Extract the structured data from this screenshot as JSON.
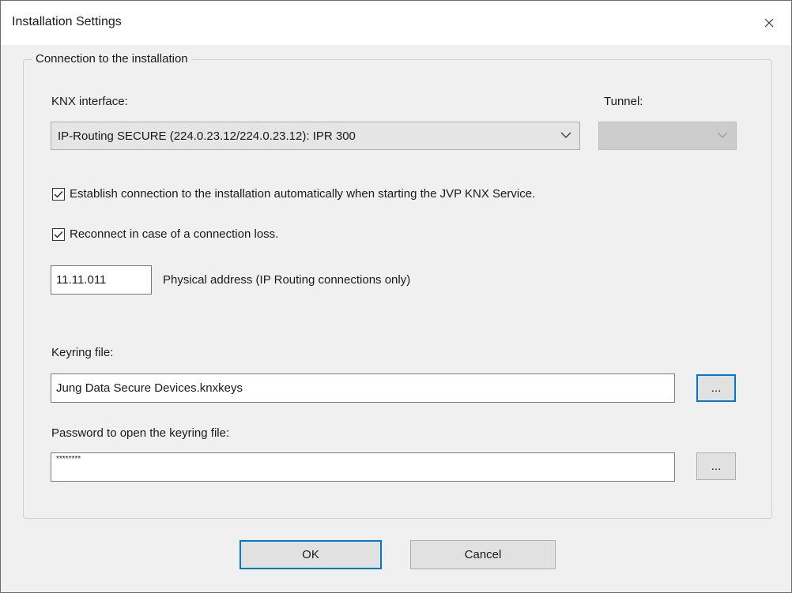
{
  "window": {
    "title": "Installation Settings"
  },
  "group": {
    "title": "Connection to the installation"
  },
  "knx_interface": {
    "label": "KNX interface:",
    "selected": "IP-Routing SECURE (224.0.23.12/224.0.23.12): IPR 300"
  },
  "tunnel": {
    "label": "Tunnel:",
    "selected": ""
  },
  "auto_connect": {
    "label": "Establish connection to the installation automatically when starting the JVP KNX Service.",
    "checked": true
  },
  "reconnect": {
    "label": "Reconnect in case of a connection loss.",
    "checked": true
  },
  "physical_address": {
    "value": "11.11.011",
    "label": "Physical address (IP Routing connections only)"
  },
  "keyring": {
    "label": "Keyring file:",
    "value": "Jung Data Secure Devices.knxkeys",
    "browse_label": "..."
  },
  "password": {
    "label": "Password to open the keyring file:",
    "value": "********",
    "browse_label": "..."
  },
  "buttons": {
    "ok": "OK",
    "cancel": "Cancel"
  },
  "colors": {
    "focus_accent": "#0078d7",
    "dialog_bg": "#f0f0f0",
    "disabled_combo": "#cccccc"
  }
}
